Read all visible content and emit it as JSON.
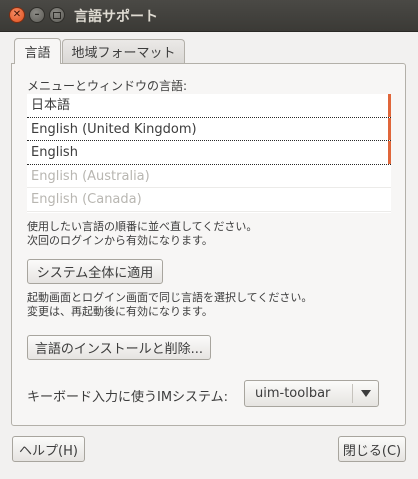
{
  "window": {
    "title": "言語サポート"
  },
  "tabs": [
    {
      "label": "言語",
      "active": true
    },
    {
      "label": "地域フォーマット",
      "active": false
    }
  ],
  "languages": {
    "heading": "メニューとウィンドウの言語:",
    "items": [
      {
        "label": "日本語",
        "enabled": true
      },
      {
        "label": "English (United Kingdom)",
        "enabled": true
      },
      {
        "label": "English",
        "enabled": true
      },
      {
        "label": "English (Australia)",
        "enabled": false
      },
      {
        "label": "English (Canada)",
        "enabled": false
      }
    ],
    "hint_line1": "使用したい言語の順番に並べ直してください。",
    "hint_line2": "次回のログインから有効になります。"
  },
  "apply_system": {
    "button_label": "システム全体に適用",
    "note_line1": "起動画面とログイン画面で同じ言語を選択してください。",
    "note_line2": "変更は、再起動後に有効になります。"
  },
  "install_button": {
    "label": "言語のインストールと削除..."
  },
  "keyboard": {
    "label": "キーボード入力に使うIMシステム:",
    "selected": "uim-toolbar"
  },
  "footer": {
    "help_label": "ヘルプ(H)",
    "close_label": "閉じる(C)"
  },
  "colors": {
    "titlebar": "#3c3b37",
    "accent_marker": "#e0663a",
    "close_button": "#e0521f",
    "window_bg": "#f2f1f0"
  }
}
